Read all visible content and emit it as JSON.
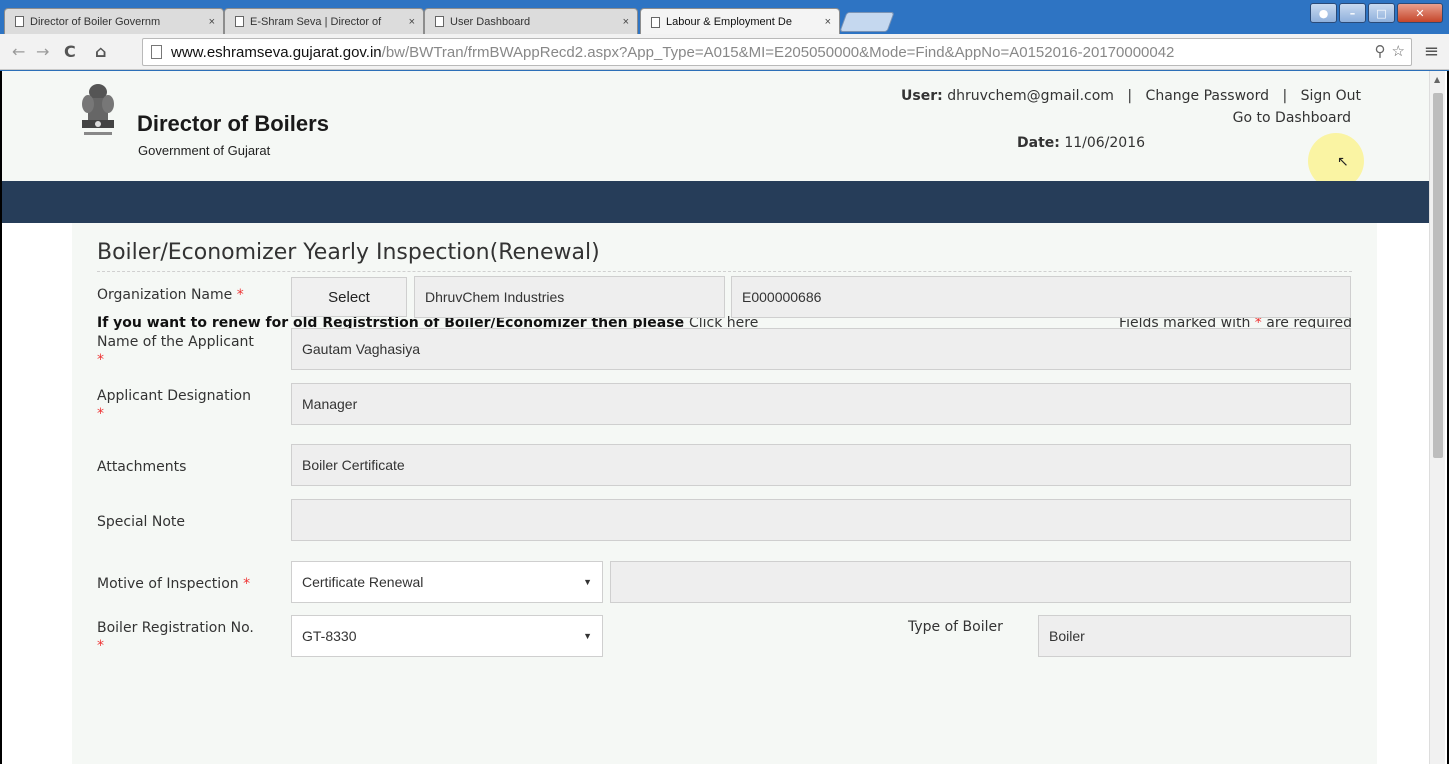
{
  "browser": {
    "tabs": [
      {
        "title": "Director of Boiler Governm",
        "active": false
      },
      {
        "title": "E-Shram Seva | Director of",
        "active": false
      },
      {
        "title": "User Dashboard",
        "active": false
      },
      {
        "title": "Labour & Employment De",
        "active": true
      }
    ],
    "tab_close_glyph": "×",
    "address": {
      "host": "www.eshramseva.gujarat.gov.in",
      "path": "/bw/BWTran/frmBWAppRecd2.aspx?App_Type=A015&MI=E205050000&Mode=Find&AppNo=A0152016-20170000042"
    },
    "icons": [
      "back-arrow-icon",
      "forward-arrow-icon",
      "reload-icon",
      "home-icon",
      "page-icon",
      "zoom-icon",
      "star-icon",
      "menu-icon"
    ]
  },
  "header": {
    "brand_title": "Director of Boilers",
    "brand_subtitle": "Government of Gujarat",
    "user_label": "User:",
    "user_email": "dhruvchem@gmail.com",
    "sep": "|",
    "change_password": "Change Password",
    "sign_out": "Sign Out",
    "go_to_dashboard": "Go to Dashboard",
    "date_label": "Date:",
    "date_value": "11/06/2016"
  },
  "form": {
    "title": "Boiler/Economizer Yearly Inspection(Renewal)",
    "renew_text": "If you want to renew for old Registrstion of Boiler/Economizer then please",
    "click_here": "Click here",
    "required_note_pre": "Fields marked with",
    "required_note_post": "are required",
    "star": "*",
    "organization": {
      "label": "Organization Name",
      "select_button": "Select",
      "name": "DhruvChem Industries",
      "code": "E000000686"
    },
    "applicant_name": {
      "label": "Name of the Applicant",
      "value": "Gautam Vaghasiya"
    },
    "designation": {
      "label": "Applicant Designation",
      "value": "Manager"
    },
    "attachments": {
      "label": "Attachments",
      "value": "Boiler Certificate"
    },
    "special_note": {
      "label": "Special Note",
      "value": ""
    },
    "motive": {
      "label": "Motive of Inspection",
      "selected": "Certificate Renewal",
      "extra": ""
    },
    "registration": {
      "label": "Boiler Registration No.",
      "selected": "GT-8330"
    },
    "boiler_type": {
      "label": "Type of Boiler",
      "value": "Boiler"
    }
  },
  "colors": {
    "nav_band": "#263d59",
    "content_bg": "#f5f8f5",
    "required": "#e33333",
    "highlight": "#fbf39a"
  }
}
